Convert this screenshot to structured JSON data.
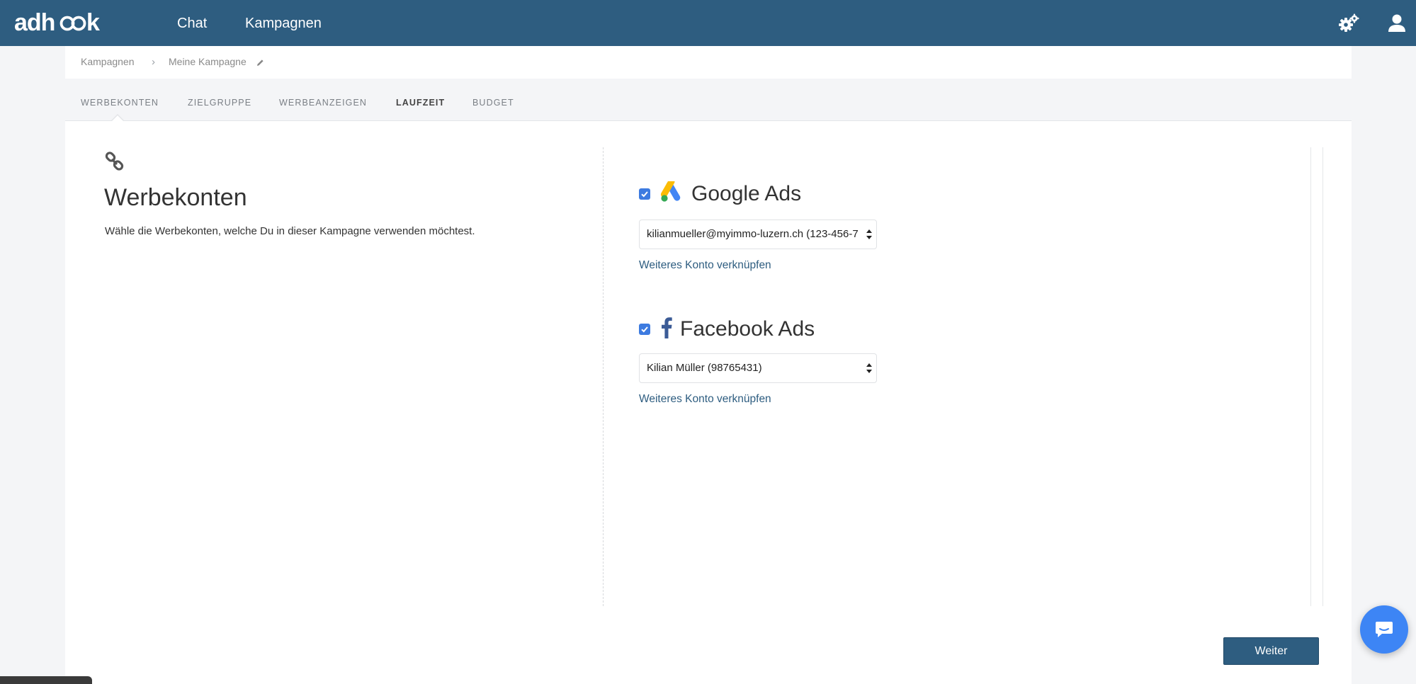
{
  "app": {
    "logo_text": "adhook"
  },
  "nav": {
    "chat": "Chat",
    "kampagnen": "Kampagnen"
  },
  "breadcrumb": {
    "root": "Kampagnen",
    "separator": "›",
    "current": "Meine Kampagne"
  },
  "tabs": [
    {
      "label": "WERBEKONTEN"
    },
    {
      "label": "ZIELGRUPPE"
    },
    {
      "label": "WERBEANZEIGEN"
    },
    {
      "label": "LAUFZEIT"
    },
    {
      "label": "BUDGET"
    }
  ],
  "section": {
    "title": "Werbekonten",
    "description": "Wähle die Werbekonten, welche Du in dieser Kampagne verwenden möchtest."
  },
  "platforms": {
    "google": {
      "name": "Google Ads",
      "checked": true,
      "selected_account": "kilianmueller@myimmo-luzern.ch (123-456-7",
      "link_more": "Weiteres Konto verknüpfen"
    },
    "facebook": {
      "name": "Facebook Ads",
      "checked": true,
      "selected_account": "Kilian Müller (98765431)",
      "link_more": "Weiteres Konto verknüpfen"
    }
  },
  "actions": {
    "next": "Weiter"
  },
  "colors": {
    "primary": "#2e5d80",
    "checkbox": "#3d7be0",
    "chat_bubble": "#3d85f5"
  }
}
